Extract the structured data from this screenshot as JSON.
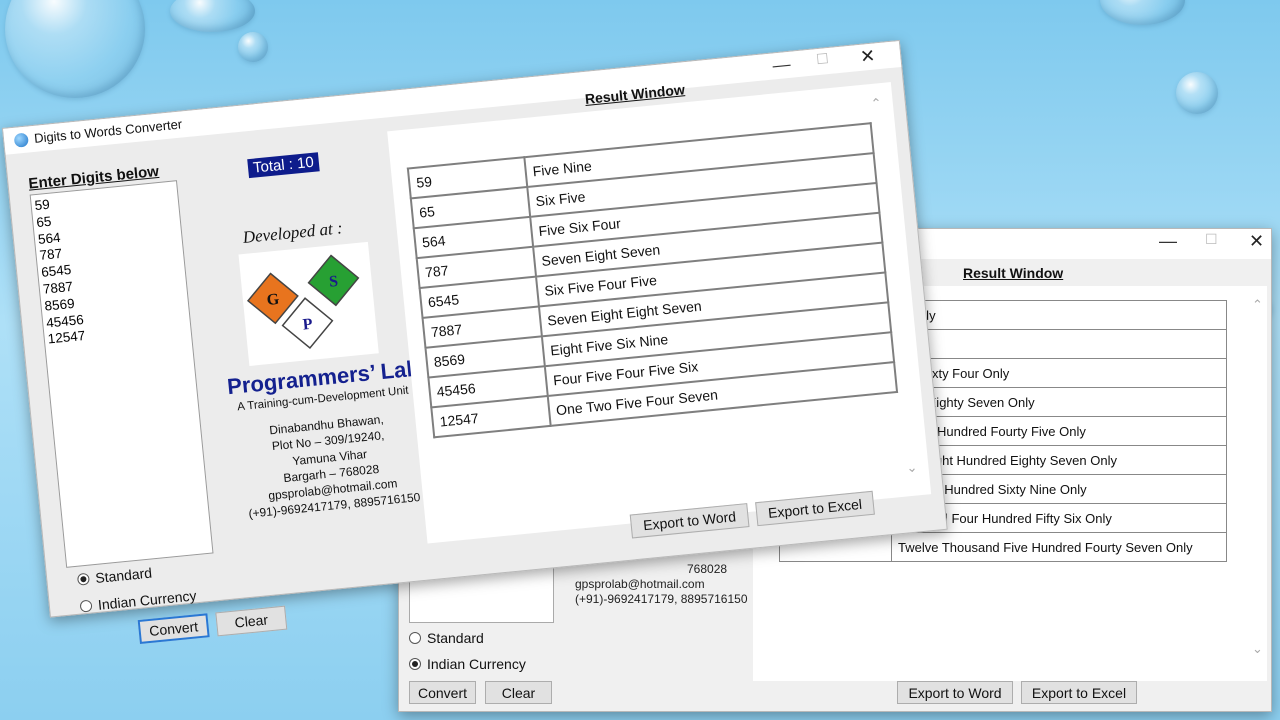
{
  "background": {
    "colors": [
      "#7ec9ee",
      "#aee0f7"
    ]
  },
  "front_window": {
    "title": "Digits to Words Converter",
    "input_label": "Enter Digits below",
    "digits": [
      "59",
      "65",
      "564",
      "787",
      "6545",
      "7887",
      "8569",
      "45456",
      "12547"
    ],
    "total_badge": "Total : 10",
    "developed_at": "Developed at :",
    "logo_letters": {
      "g": "G",
      "s": "S",
      "p": "P"
    },
    "org_name": "Programmers’ Lab",
    "org_tagline": "A Training-cum-Development Unit",
    "address": [
      "Dinabandhu Bhawan,",
      "Plot No – 309/19240,",
      "Yamuna Vihar",
      "Bargarh – 768028",
      "gpsprolab@hotmail.com",
      "(+91)-9692417179, 8895716150"
    ],
    "result_title": "Result Window",
    "rows": [
      {
        "num": "59",
        "words": "Five Nine"
      },
      {
        "num": "65",
        "words": "Six Five"
      },
      {
        "num": "564",
        "words": "Five Six Four"
      },
      {
        "num": "787",
        "words": "Seven Eight Seven"
      },
      {
        "num": "6545",
        "words": "Six Five Four Five"
      },
      {
        "num": "7887",
        "words": "Seven Eight Eight Seven"
      },
      {
        "num": "8569",
        "words": "Eight Five Six Nine"
      },
      {
        "num": "45456",
        "words": "Four Five Four Five Six"
      },
      {
        "num": "12547",
        "words": "One Two Five Four Seven"
      }
    ],
    "radio_standard": "Standard",
    "radio_indian": "Indian Currency",
    "selected_mode": "Standard",
    "convert_label": "Convert",
    "clear_label": "Clear",
    "export_word_label": "Export to Word",
    "export_excel_label": "Export to Excel"
  },
  "back_window": {
    "result_title": "Result Window",
    "address_partial": [
      "768028",
      "gpsprolab@hotmail.com",
      "(+91)-9692417179, 8895716150"
    ],
    "rows": [
      {
        "num": "",
        "words": "e Only"
      },
      {
        "num": "",
        "words": "Only"
      },
      {
        "num": "",
        "words": "red Sixty Four Only"
      },
      {
        "num": "",
        "words": "dred Eighty Seven Only"
      },
      {
        "num": "",
        "words": "d Five Hundred Fourty Five Only"
      },
      {
        "num": "",
        "words": "and Eight Hundred Eighty Seven Only"
      },
      {
        "num": "",
        "words": "nd Five Hundred Sixty Nine Only"
      },
      {
        "num": "",
        "words": "housand Four Hundred Fifty Six Only"
      },
      {
        "num": "",
        "words": "Twelve Thousand Five Hundred Fourty Seven Only"
      }
    ],
    "radio_standard": "Standard",
    "radio_indian": "Indian Currency",
    "selected_mode": "Indian Currency",
    "convert_label": "Convert",
    "clear_label": "Clear",
    "export_word_label": "Export to Word",
    "export_excel_label": "Export to Excel"
  }
}
